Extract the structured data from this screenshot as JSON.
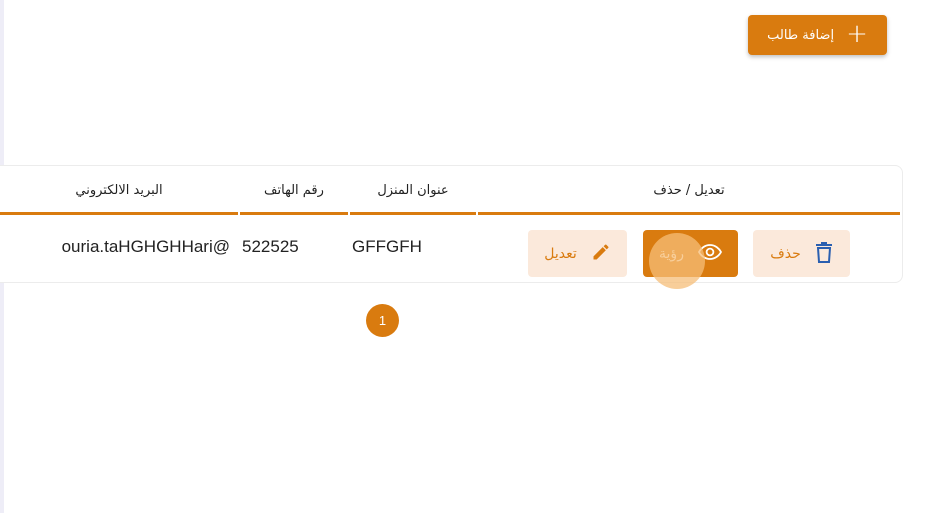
{
  "toolbar": {
    "add_student_label": "إضافة طالب",
    "add_icon": "plus-icon"
  },
  "table": {
    "headers": {
      "actions": "تعديل / حذف",
      "address": "عنوان المنزل",
      "phone": "رقم الهاتف",
      "email": "البريد الالكتروني"
    },
    "rows": [
      {
        "email": "ouria.taHGHGHHari@",
        "phone": "522525",
        "address": "GFFGFH",
        "edit_label": "تعديل",
        "view_label": "رؤية",
        "delete_label": "حذف"
      }
    ]
  },
  "pagination": {
    "current_page": "1"
  },
  "colors": {
    "accent": "#d97b0f",
    "accent_light": "#fbe9db"
  }
}
